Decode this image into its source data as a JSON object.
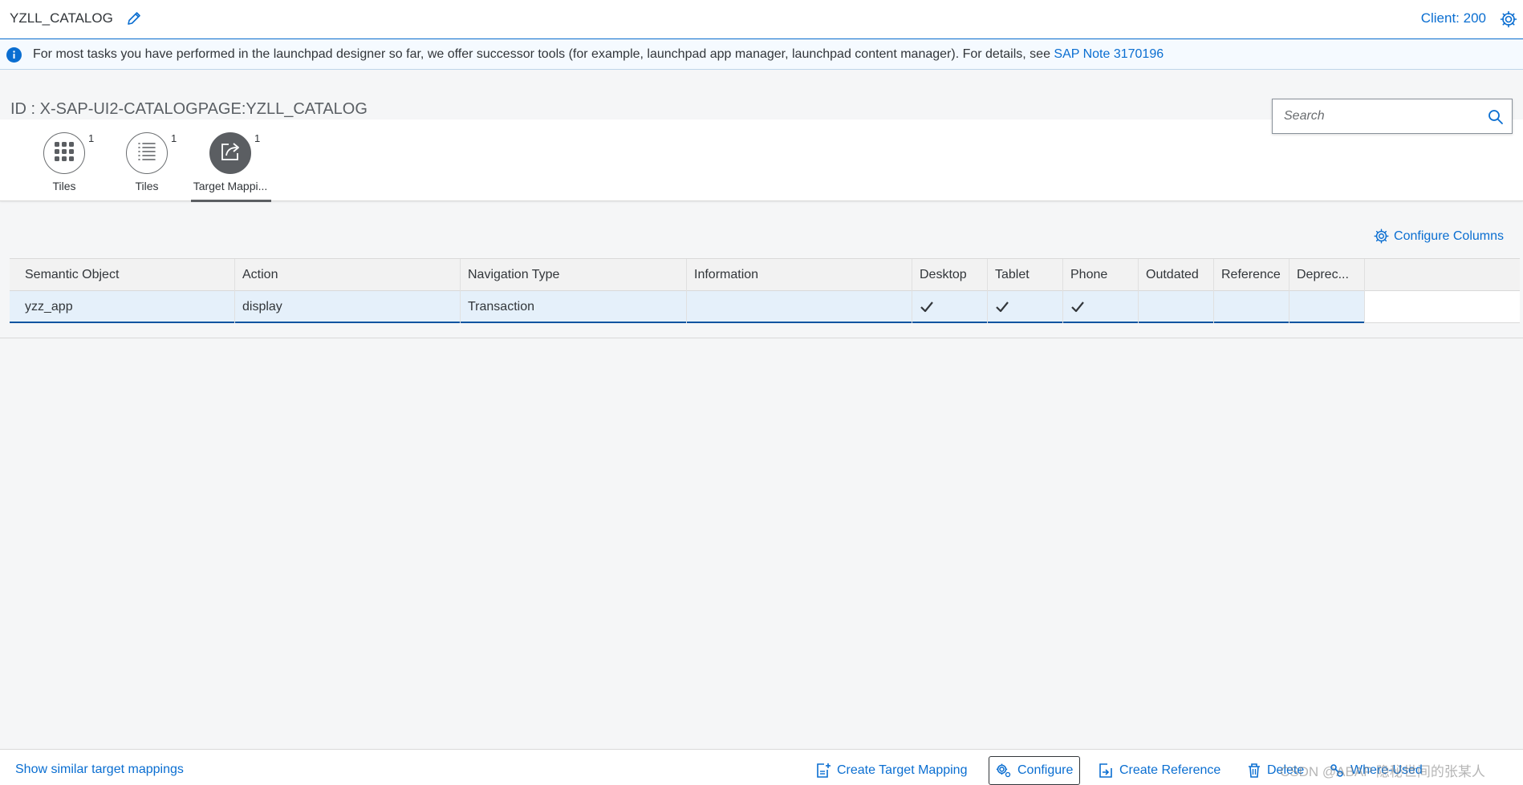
{
  "shell": {
    "title": "YZLL_CATALOG",
    "client": "Client: 200"
  },
  "info": {
    "message": "For most tasks you have performed in the launchpad designer so far, we offer successor tools (for example, launchpad app manager, launchpad content manager). For details, see ",
    "link": "SAP Note 3170196"
  },
  "page": {
    "id": "ID : X-SAP-UI2-CATALOGPAGE:YZLL_CATALOG"
  },
  "search": {
    "placeholder": "Search"
  },
  "tabs": [
    {
      "label": "Tiles",
      "count": "1",
      "icon": "grid-icon"
    },
    {
      "label": "Tiles",
      "count": "1",
      "icon": "list-icon"
    },
    {
      "label": "Target Mappi...",
      "count": "1",
      "icon": "share-icon",
      "selected": true
    }
  ],
  "toolbar": {
    "configure_columns": "Configure Columns"
  },
  "table": {
    "columns": [
      "Semantic Object",
      "Action",
      "Navigation Type",
      "Information",
      "Desktop",
      "Tablet",
      "Phone",
      "Outdated",
      "Reference",
      "Deprec..."
    ],
    "rows": [
      {
        "semantic_object": "yzz_app",
        "action": "display",
        "navigation_type": "Transaction",
        "information": "",
        "desktop": true,
        "tablet": true,
        "phone": true,
        "outdated": "",
        "reference": "",
        "deprecated": ""
      }
    ]
  },
  "footer": {
    "show_similar": "Show similar target mappings",
    "create_target_mapping": "Create Target Mapping",
    "configure": "Configure",
    "create_reference": "Create Reference",
    "delete": "Delete",
    "where_used": "Where-Used",
    "watermark": "CSDN @ABAP 隐秘世间的张某人"
  },
  "colors": {
    "accent": "#0a6ed1",
    "selected_row": "#e5f0fa",
    "selected_tab": "#5b5e62"
  }
}
